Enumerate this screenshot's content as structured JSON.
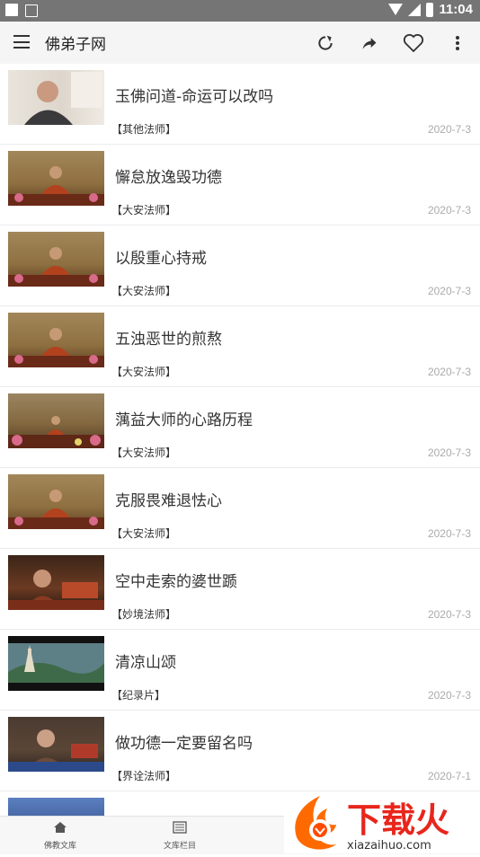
{
  "status_bar": {
    "time": "11:04"
  },
  "app_bar": {
    "title": "佛弟子网"
  },
  "articles": [
    {
      "title": "玉佛问道-命运可以改吗",
      "category": "【其他法师】",
      "date": "2020-7-3"
    },
    {
      "title": "懈怠放逸毁功德",
      "category": "【大安法师】",
      "date": "2020-7-3"
    },
    {
      "title": "以殷重心持戒",
      "category": "【大安法师】",
      "date": "2020-7-3"
    },
    {
      "title": "五浊恶世的煎熬",
      "category": "【大安法师】",
      "date": "2020-7-3"
    },
    {
      "title": "蕅益大师的心路历程",
      "category": "【大安法师】",
      "date": "2020-7-3"
    },
    {
      "title": "克服畏难退怯心",
      "category": "【大安法师】",
      "date": "2020-7-3"
    },
    {
      "title": "空中走索的婆世踬",
      "category": "【妙境法师】",
      "date": "2020-7-3"
    },
    {
      "title": "清凉山颂",
      "category": "【纪录片】",
      "date": "2020-7-3"
    },
    {
      "title": "做功德一定要留名吗",
      "category": "【界诠法师】",
      "date": "2020-7-1"
    }
  ],
  "bottom_nav": [
    {
      "label": "佛教文库"
    },
    {
      "label": "文库栏目"
    }
  ],
  "watermark": {
    "brand": "下载火",
    "url": "xiazaihuo.com"
  }
}
